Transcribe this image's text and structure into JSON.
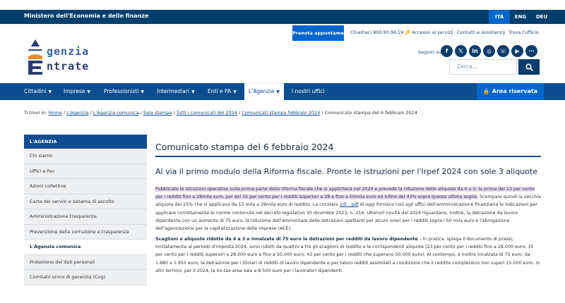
{
  "topbar": {
    "ministry": "Ministero dell'Economia e delle finanze",
    "languages": [
      "ITA",
      "ENG",
      "DEU"
    ]
  },
  "header": {
    "prenota": "Prenota appuntamento",
    "chiamaci": "Chiamaci 800.90.96.96",
    "accesso": "Accesso ai servizi",
    "contatti": "Contatti e assistenza",
    "trova": "Trova l'ufficio",
    "seguici": "Seguici su:",
    "social": [
      "f",
      "𝕏",
      "in",
      "◎",
      "☏",
      "▶",
      "⋯"
    ],
    "search_placeholder": "Cerca...",
    "logo_line1": "genzia",
    "logo_line2": "ntrate"
  },
  "nav": {
    "items": [
      "Cittadini",
      "Imprese",
      "Professionisti",
      "Intermediari",
      "Enti e PA",
      "L'Agenzia",
      "I nostri uffici"
    ],
    "riservata": "Area riservata"
  },
  "breadcrumb": {
    "prefix": "Ti trovi in:",
    "links": [
      "Home",
      "L'Agenzia",
      "L'Agenzia comunica",
      "Sala stampa",
      "Tutti i comunicati del 2024",
      "Comunicati stampa febbraio 2024"
    ],
    "current": "Comunicato stampa del 6 febbraio 2024"
  },
  "sidebar": {
    "title": "L'AGENZIA",
    "items": [
      "Chi siamo",
      "Uffici e Pec",
      "Azioni collettive",
      "Carta dei servizi e sistema di ascolto",
      "Amministrazione trasparente",
      "Prevenzione della corruzione e trasparenza",
      "L'Agenzia comunica",
      "Protezione dei dati personali",
      "Comitato unico di garanzia (Cug)"
    ]
  },
  "main": {
    "title": "Comunicato stampa del 6 febbraio 2024",
    "subtitle": "Al via il primo modulo della Riforma fiscale. Pronte le istruzioni per l'Irpef 2024 con sole 3 aliquote",
    "para1_highlight": "Pubblicate le istruzioni operative sulla prima parte della riforma fiscale che si applicherà nel 2024 e prevede la riduzione delle aliquote da 4 a 3: la prima del 23 per cento per i redditi fino a 28mila euro, poi del 35 per cento per i redditi superiori a 28 e fino a 50mila euro ed infine del 43% sopra questa ultima soglia.",
    "para1_rest_a": " Scompare quindi la vecchia aliquota del 25% che si applicava da 15 mila a 28mila euro di reddito. La circolare ",
    "para1_link": "2/E - pdf",
    "para1_rest_b": " di oggi fornisce così agli uffici dell'amministrazione finanziaria le indicazioni per applicare correttamente le norme contenute nel decreto legislativo 30 dicembre 2023, n. 216. Ulteriori novità del 2024 riguardano, inoltre, la detrazione da lavoro dipendente con un aumento di 75 euro, la riduzione dell'ammontare delle detrazioni spettanti per alcuni oneri per i redditi sopra i 50 mila euro e l'abrogazione dell'agevolazione per la capitalizzazione delle imprese (ACE).",
    "para2_bold": "Scaglioni e aliquote ridotte da 4 a 3 e innalzate di 75 euro le detrazioni per redditi da lavoro dipendente",
    "para2_rest": " – In pratica, spiega il documento di prassi, limitatamente al periodo d'imposta 2024, sono ridotti da quattro a tre gli scaglioni di reddito e le corrispondenti aliquote (23 per cento per i redditi fino a 28.000 euro; 35 per cento per i redditi superiori a 28.000 euro e fino a 50.000 euro; 43 per cento per i redditi che superano 50.000 euro). Al contempo, è inoltre innalzata di 75 euro, da 1.880 a 1.955 euro, la detrazione per i titolari di redditi di lavoro dipendente e per taluni redditi assimilati a condizione che il reddito complessivo non superi 15.000 euro. In altri termini, per il 2024, la no-tax area sale a 8.500 euro per i lavoratori dipendenti."
  }
}
